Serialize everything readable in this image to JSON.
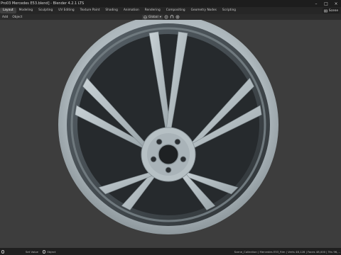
{
  "window": {
    "title": "Pro03 Mercedes E53.blend] - Blender 4.2.1 LTS",
    "buttons": {
      "minimize": "–",
      "maximize": "□",
      "close": "×"
    }
  },
  "workspaces": [
    {
      "label": "Layout",
      "active": true
    },
    {
      "label": "Modeling",
      "active": false
    },
    {
      "label": "Sculpting",
      "active": false
    },
    {
      "label": "UV Editing",
      "active": false
    },
    {
      "label": "Texture Paint",
      "active": false
    },
    {
      "label": "Shading",
      "active": false
    },
    {
      "label": "Animation",
      "active": false
    },
    {
      "label": "Rendering",
      "active": false
    },
    {
      "label": "Compositing",
      "active": false
    },
    {
      "label": "Geometry Nodes",
      "active": false
    },
    {
      "label": "Scripting",
      "active": false
    }
  ],
  "scene": {
    "label": "Scene",
    "icon": "scene-icon"
  },
  "toolbar": {
    "add": "Add",
    "object": "Object",
    "orientation": "Global",
    "pivot_icon": "pivot-icon",
    "snap_icon": "snap-icon",
    "proportional_icon": "proportional-edit-icon"
  },
  "statusbar": {
    "left": "Set Value",
    "mid": "Object",
    "right": "Scene_Collection | Mercedes E53_Rim | Verts 48,128 | Faces 48,000 | Tris 96,..."
  },
  "colors": {
    "viewport_bg": "#3d3d3d",
    "wheel_face": "#b7c1c6",
    "wheel_shadow": "#6c767b",
    "wheel_dark": "#2b2f32",
    "accent_active_tab": "#404040"
  }
}
